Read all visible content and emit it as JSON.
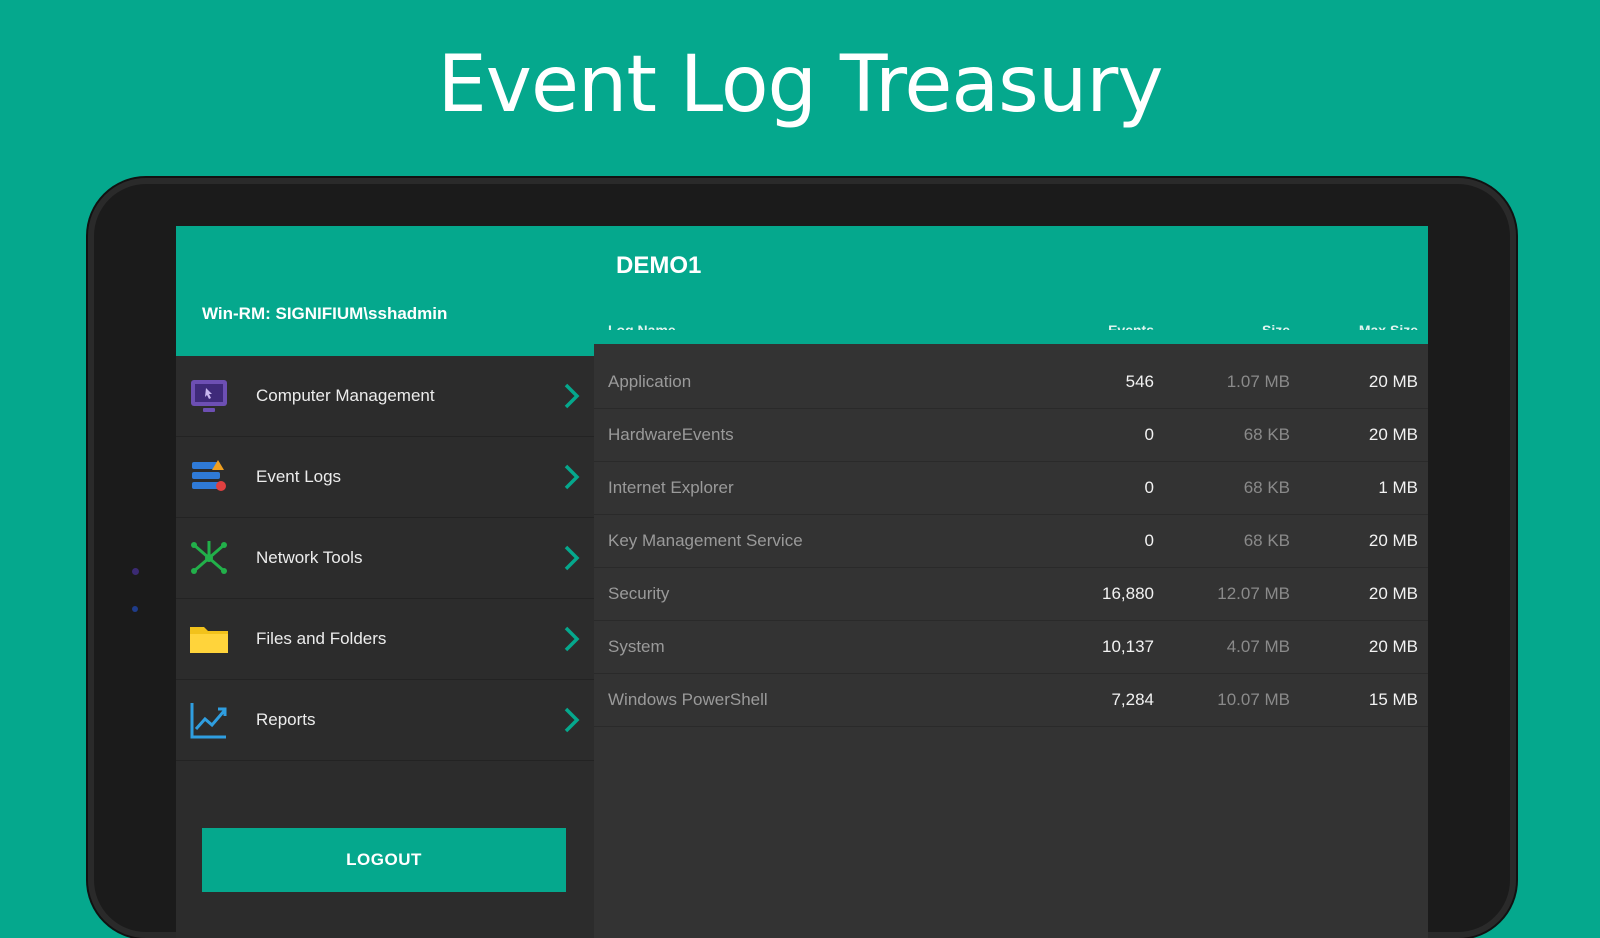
{
  "banner": {
    "title": "Event Log Treasury"
  },
  "drawer": {
    "account": "Win-RM: SIGNIFIUM\\sshadmin",
    "items": [
      {
        "label": "Computer Management",
        "icon": "monitor-icon"
      },
      {
        "label": "Event Logs",
        "icon": "event-log-icon"
      },
      {
        "label": "Network Tools",
        "icon": "network-icon"
      },
      {
        "label": "Files and Folders",
        "icon": "folder-icon"
      },
      {
        "label": "Reports",
        "icon": "chart-icon"
      }
    ],
    "logout_label": "LOGOUT"
  },
  "content": {
    "host": "DEMO1",
    "columns": {
      "name": "Log Name",
      "events": "Events",
      "size": "Size",
      "max": "Max Size"
    },
    "rows": [
      {
        "name": "Application",
        "events": "546",
        "size": "1.07 MB",
        "max": "20 MB"
      },
      {
        "name": "HardwareEvents",
        "events": "0",
        "size": "68 KB",
        "max": "20 MB"
      },
      {
        "name": "Internet Explorer",
        "events": "0",
        "size": "68 KB",
        "max": "1 MB"
      },
      {
        "name": "Key Management Service",
        "events": "0",
        "size": "68 KB",
        "max": "20 MB"
      },
      {
        "name": "Security",
        "events": "16,880",
        "size": "12.07 MB",
        "max": "20 MB"
      },
      {
        "name": "System",
        "events": "10,137",
        "size": "4.07 MB",
        "max": "20 MB"
      },
      {
        "name": "Windows PowerShell",
        "events": "7,284",
        "size": "10.07 MB",
        "max": "15 MB"
      }
    ]
  },
  "colors": {
    "accent": "#05A88D",
    "panel": "#2c2c2c",
    "content": "#333333"
  }
}
